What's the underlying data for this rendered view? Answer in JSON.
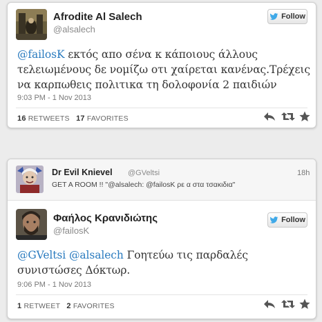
{
  "tweet1": {
    "display_name": "Afrodite Al Salech",
    "handle": "@alsalech",
    "follow_label": "Follow",
    "mention": "@failosK",
    "text_rest": " εκτός απο σένα κ κάποιους άλλους τελειωμένους δε νομίζω οτι χαίρεται κανένας.Τρέχεις να καρπωθεις πολιτικα τη δολοφονία 2 παιδιών",
    "timestamp": "9:03 PM - 1 Nov 2013",
    "retweets_count": "16",
    "retweets_label": "RETWEETS",
    "favorites_count": "17",
    "favorites_label": "FAVORITES"
  },
  "tweet2": {
    "parent": {
      "display_name": "Dr Evil Knievel",
      "handle": "@GVeltsi",
      "time": "18h",
      "text": "GET A ROOM !! \"@alsalech: @failosK ρε α στα τσακιδια\""
    },
    "display_name": "Φαήλος Κρανιδιώτης",
    "handle": "@failosK",
    "follow_label": "Follow",
    "mention1": "@GVeltsi",
    "mention2": "@alsalech",
    "text_rest": " Γοητεύω τις παρδαλές συνιστώσες Δόκτωρ.",
    "timestamp": "9:06 PM - 1 Nov 2013",
    "retweets_count": "1",
    "retweets_label": "RETWEET",
    "favorites_count": "2",
    "favorites_label": "FAVORITES"
  },
  "colors": {
    "link": "#2a7bbf",
    "twitter_bird": "#3fa9e8"
  },
  "icons": [
    "twitter-bird-icon",
    "reply-icon",
    "retweet-icon",
    "favorite-star-icon"
  ]
}
